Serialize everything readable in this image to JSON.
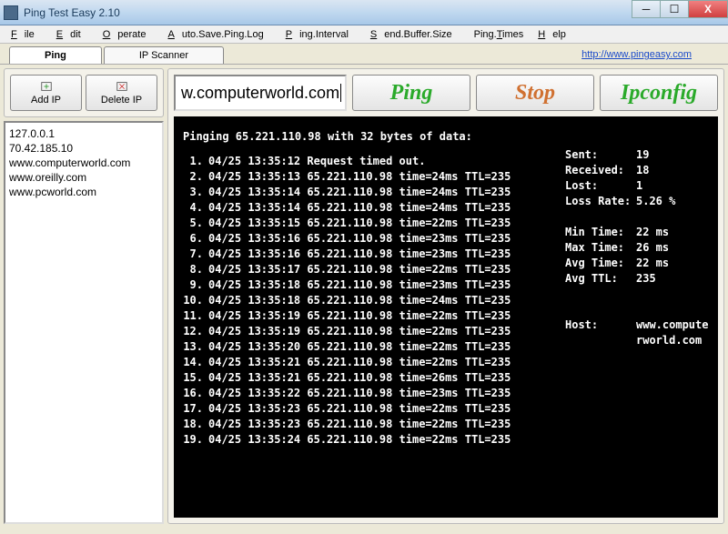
{
  "window": {
    "title": "Ping Test Easy 2.10"
  },
  "menu": {
    "file": "File",
    "edit": "Edit",
    "operate": "Operate",
    "autosave": "Auto.Save.Ping.Log",
    "interval": "Ping.Interval",
    "buffer": "Send.Buffer.Size",
    "times": "Ping.Times",
    "help": "Help"
  },
  "tabs": {
    "ping": "Ping",
    "scanner": "IP Scanner",
    "link": "http://www.pingeasy.com"
  },
  "toolbar": {
    "add": "Add IP",
    "delete": "Delete IP"
  },
  "iplist": [
    "127.0.0.1",
    "70.42.185.10",
    "www.computerworld.com",
    "www.oreilly.com",
    "www.pcworld.com"
  ],
  "hostinput": "w.computerworld.com",
  "buttons": {
    "ping": "Ping",
    "stop": "Stop",
    "ipconfig": "Ipconfig"
  },
  "terminal": {
    "header": "Pinging  65.221.110.98  with 32 bytes of data:",
    "lines": [
      "04/25 13:35:12 Request timed out.",
      "04/25 13:35:13 65.221.110.98  time=24ms  TTL=235",
      "04/25 13:35:14 65.221.110.98  time=24ms  TTL=235",
      "04/25 13:35:14 65.221.110.98  time=24ms  TTL=235",
      "04/25 13:35:15 65.221.110.98  time=22ms  TTL=235",
      "04/25 13:35:16 65.221.110.98  time=23ms  TTL=235",
      "04/25 13:35:16 65.221.110.98  time=23ms  TTL=235",
      "04/25 13:35:17 65.221.110.98  time=22ms  TTL=235",
      "04/25 13:35:18 65.221.110.98  time=23ms  TTL=235",
      "04/25 13:35:18 65.221.110.98  time=24ms  TTL=235",
      "04/25 13:35:19 65.221.110.98  time=22ms  TTL=235",
      "04/25 13:35:19 65.221.110.98  time=22ms  TTL=235",
      "04/25 13:35:20 65.221.110.98  time=22ms  TTL=235",
      "04/25 13:35:21 65.221.110.98  time=22ms  TTL=235",
      "04/25 13:35:21 65.221.110.98  time=26ms  TTL=235",
      "04/25 13:35:22 65.221.110.98  time=23ms  TTL=235",
      "04/25 13:35:23 65.221.110.98  time=22ms  TTL=235",
      "04/25 13:35:23 65.221.110.98  time=22ms  TTL=235",
      "04/25 13:35:24 65.221.110.98  time=22ms  TTL=235"
    ]
  },
  "stats": {
    "sent_l": "Sent:",
    "sent_v": "19",
    "recv_l": "Received:",
    "recv_v": "18",
    "lost_l": "Lost:",
    "lost_v": "1",
    "rate_l": "Loss Rate:",
    "rate_v": "5.26 %",
    "min_l": "Min Time:",
    "min_v": "22 ms",
    "max_l": "Max Time:",
    "max_v": "26 ms",
    "avg_l": "Avg Time:",
    "avg_v": "22 ms",
    "ttl_l": "Avg TTL:",
    "ttl_v": "235",
    "host_l": "Host:",
    "host_v": "www.computerworld.com"
  }
}
